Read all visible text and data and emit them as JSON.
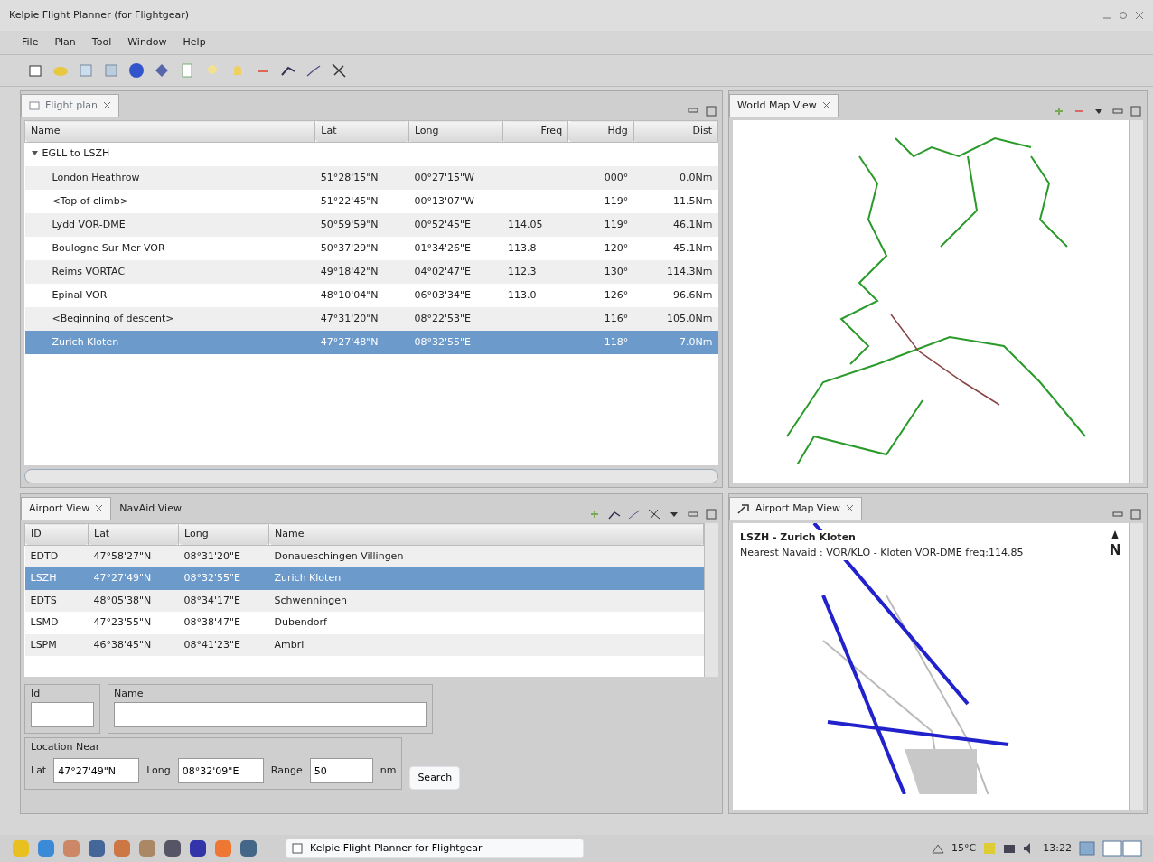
{
  "window": {
    "title": "Kelpie Flight Planner (for Flightgear)"
  },
  "menu": [
    "File",
    "Plan",
    "Tool",
    "Window",
    "Help"
  ],
  "flight_plan": {
    "tab": "Flight plan",
    "columns": [
      "Name",
      "Lat",
      "Long",
      "Freq",
      "Hdg",
      "Dist"
    ],
    "group": {
      "label": "EGLL to LSZH",
      "expanded": true,
      "rows": [
        {
          "cells": [
            "London Heathrow",
            "51°28'15\"N",
            "00°27'15\"W",
            "",
            "000°",
            "0.0Nm"
          ],
          "selected": false
        },
        {
          "cells": [
            "<Top of climb>",
            "51°22'45\"N",
            "00°13'07\"W",
            "",
            "119°",
            "11.5Nm"
          ],
          "selected": false
        },
        {
          "cells": [
            "Lydd VOR-DME",
            "50°59'59\"N",
            "00°52'45\"E",
            "114.05",
            "119°",
            "46.1Nm"
          ],
          "selected": false
        },
        {
          "cells": [
            "Boulogne Sur Mer VOR",
            "50°37'29\"N",
            "01°34'26\"E",
            "113.8",
            "120°",
            "45.1Nm"
          ],
          "selected": false
        },
        {
          "cells": [
            "Reims VORTAC",
            "49°18'42\"N",
            "04°02'47\"E",
            "112.3",
            "130°",
            "114.3Nm"
          ],
          "selected": false
        },
        {
          "cells": [
            "Epinal VOR",
            "48°10'04\"N",
            "06°03'34\"E",
            "113.0",
            "126°",
            "96.6Nm"
          ],
          "selected": false
        },
        {
          "cells": [
            "<Beginning of descent>",
            "47°31'20\"N",
            "08°22'53\"E",
            "",
            "116°",
            "105.0Nm"
          ],
          "selected": false
        },
        {
          "cells": [
            "Zurich Kloten",
            "47°27'48\"N",
            "08°32'55\"E",
            "",
            "118°",
            "7.0Nm"
          ],
          "selected": true
        }
      ]
    }
  },
  "world_map": {
    "tab": "World Map View"
  },
  "airport_panel": {
    "tabs": [
      {
        "label": "Airport View",
        "selected": true
      },
      {
        "label": "NavAid View",
        "selected": false
      }
    ],
    "columns": [
      "ID",
      "Lat",
      "Long",
      "Name"
    ],
    "rows": [
      {
        "cells": [
          "EDTD",
          "47°58'27\"N",
          "08°31'20\"E",
          "Donaueschingen Villingen"
        ],
        "selected": false
      },
      {
        "cells": [
          "LSZH",
          "47°27'49\"N",
          "08°32'55\"E",
          "Zurich Kloten"
        ],
        "selected": true
      },
      {
        "cells": [
          "EDTS",
          "48°05'38\"N",
          "08°34'17\"E",
          "Schwenningen"
        ],
        "selected": false
      },
      {
        "cells": [
          "LSMD",
          "47°23'55\"N",
          "08°38'47\"E",
          "Dubendorf"
        ],
        "selected": false
      },
      {
        "cells": [
          "LSPM",
          "46°38'45\"N",
          "08°41'23\"E",
          "Ambri"
        ],
        "selected": false
      }
    ],
    "search": {
      "id_label": "Id",
      "name_label": "Name",
      "location_label": "Location Near",
      "lat_label": "Lat",
      "lat": "47°27'49\"N",
      "long_label": "Long",
      "long": "08°32'09\"E",
      "range_label": "Range",
      "range": "50",
      "unit": "nm",
      "button": "Search"
    }
  },
  "airport_map": {
    "tab": "Airport Map View",
    "title": "LSZH - Zurich Kloten",
    "nearest": "Nearest Navaid : VOR/KLO - Kloten VOR-DME freq:114.85",
    "north": "N"
  },
  "taskbar": {
    "task": "Kelpie Flight Planner for Flightgear",
    "temperature": "15°C",
    "time": "13:22"
  }
}
